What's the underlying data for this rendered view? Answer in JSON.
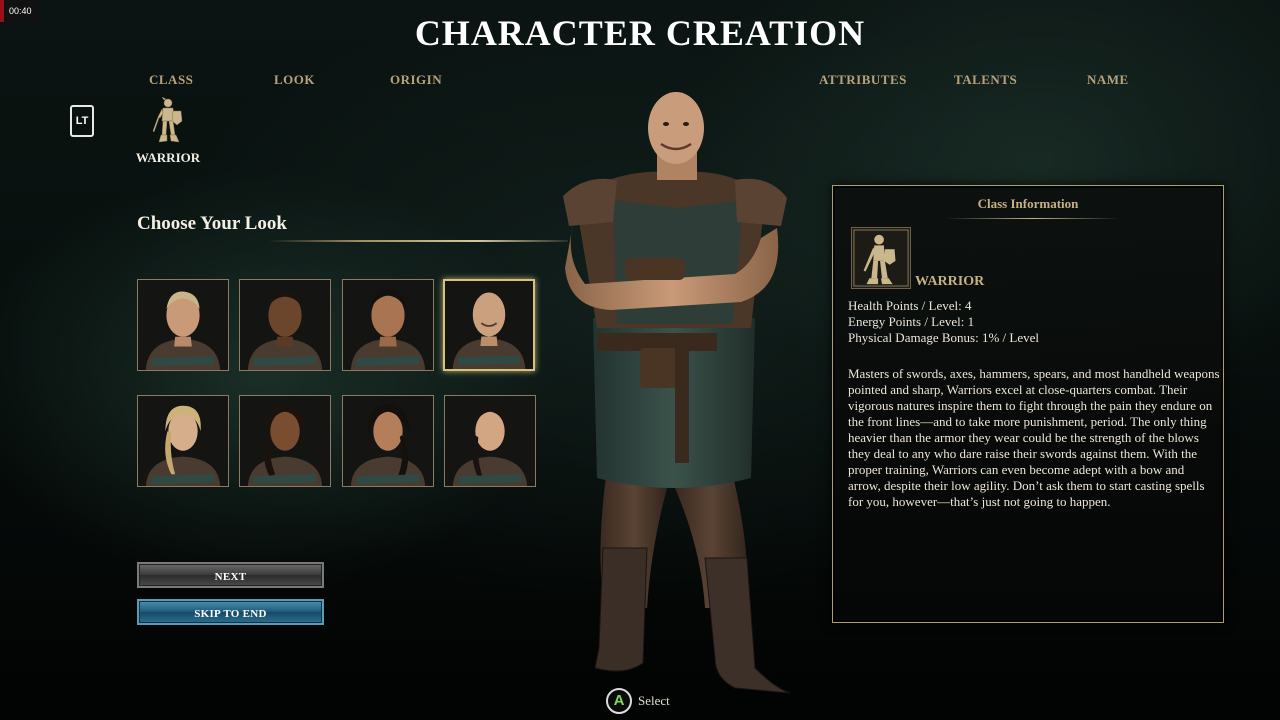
{
  "clock": "00:40",
  "title": "CHARACTER CREATION",
  "tabs": [
    {
      "label": "CLASS"
    },
    {
      "label": "LOOK"
    },
    {
      "label": "ORIGIN"
    },
    {
      "label": "ATTRIBUTES"
    },
    {
      "label": "TALENTS"
    },
    {
      "label": "NAME"
    }
  ],
  "bumper": {
    "label": "LT"
  },
  "selected_class": {
    "name": "WARRIOR",
    "icon": "warrior-figure-icon"
  },
  "look": {
    "heading": "Choose Your Look",
    "portraits": [
      {
        "id": "male-1",
        "selected": false
      },
      {
        "id": "male-2",
        "selected": false
      },
      {
        "id": "male-3",
        "selected": false
      },
      {
        "id": "male-4",
        "selected": true
      },
      {
        "id": "female-1",
        "selected": false
      },
      {
        "id": "female-2",
        "selected": false
      },
      {
        "id": "female-3",
        "selected": false
      },
      {
        "id": "female-4",
        "selected": false
      }
    ]
  },
  "buttons": {
    "next": "NEXT",
    "skip": "SKIP TO END"
  },
  "info": {
    "title": "Class Information",
    "class_name": "WARRIOR",
    "stats": [
      "Health Points / Level: 4",
      "Energy Points / Level: 1",
      "Physical Damage Bonus: 1% / Level"
    ],
    "description": "Masters of swords, axes, hammers, spears, and most handheld weapons pointed and sharp, Warriors excel at close-quarters combat. Their vigorous natures inspire them to fight through the pain they endure on the front lines—and to take more punishment, period. The only thing heavier than the armor they wear could be the strength of the blows they deal to any who dare raise their swords against them. With the proper training, Warriors can even become adept with a bow and arrow, despite their low agility. Don’t ask them to start casting spells for you, however—that’s just not going to happen."
  },
  "hint": {
    "button": "A",
    "label": "Select"
  },
  "colors": {
    "accent_gold": "#c7b285",
    "skip_blue": "#1e5a7a",
    "a_green": "#7ed957"
  }
}
